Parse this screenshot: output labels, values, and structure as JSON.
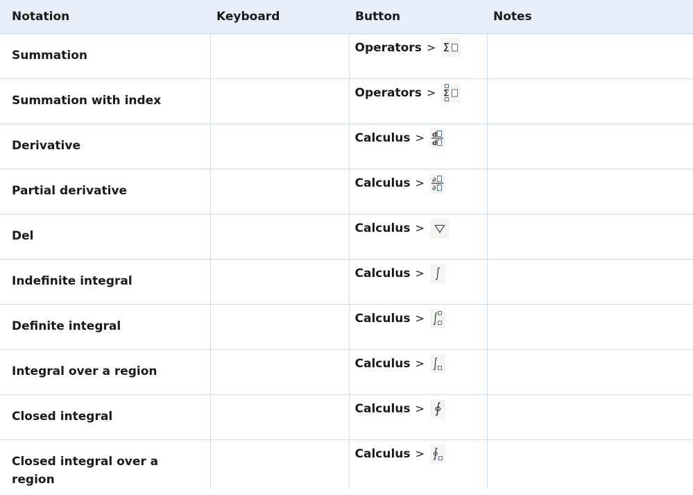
{
  "table": {
    "headers": {
      "notation": "Notation",
      "keyboard": "Keyboard",
      "button": "Button",
      "notes": "Notes"
    },
    "separator": ">",
    "rows": [
      {
        "notation": "Summation",
        "keyboard": "",
        "menu": "Operators",
        "icon": "summation-icon",
        "notes": ""
      },
      {
        "notation": "Summation with index",
        "keyboard": "",
        "menu": "Operators",
        "icon": "summation-with-index-icon",
        "notes": ""
      },
      {
        "notation": "Derivative",
        "keyboard": "",
        "menu": "Calculus",
        "icon": "derivative-icon",
        "notes": ""
      },
      {
        "notation": "Partial derivative",
        "keyboard": "",
        "menu": "Calculus",
        "icon": "partial-derivative-icon",
        "notes": ""
      },
      {
        "notation": "Del",
        "keyboard": "",
        "menu": "Calculus",
        "icon": "del-icon",
        "notes": ""
      },
      {
        "notation": "Indefinite integral",
        "keyboard": "",
        "menu": "Calculus",
        "icon": "indefinite-integral-icon",
        "notes": ""
      },
      {
        "notation": "Definite integral",
        "keyboard": "",
        "menu": "Calculus",
        "icon": "definite-integral-icon",
        "notes": ""
      },
      {
        "notation": "Integral over a region",
        "keyboard": "",
        "menu": "Calculus",
        "icon": "region-integral-icon",
        "notes": ""
      },
      {
        "notation": "Closed integral",
        "keyboard": "",
        "menu": "Calculus",
        "icon": "closed-integral-icon",
        "notes": ""
      },
      {
        "notation": "Closed integral over a region",
        "keyboard": "",
        "menu": "Calculus",
        "icon": "closed-region-integral-icon",
        "notes": ""
      }
    ]
  }
}
